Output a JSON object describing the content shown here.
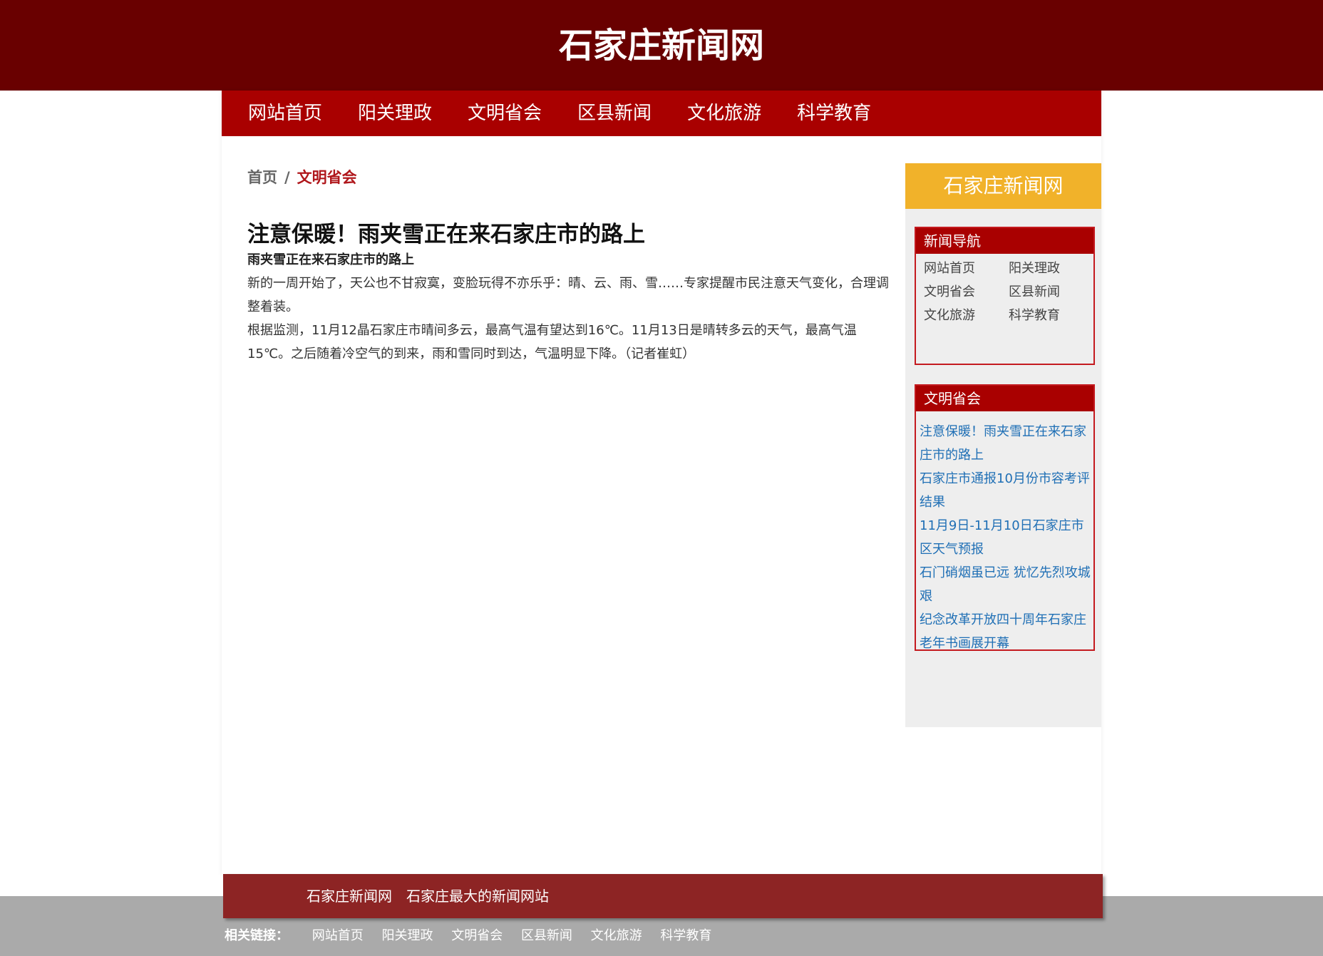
{
  "header": {
    "site_title": "石家庄新闻网"
  },
  "nav": {
    "items": [
      {
        "label": "网站首页"
      },
      {
        "label": "阳关理政"
      },
      {
        "label": "文明省会"
      },
      {
        "label": "区县新闻"
      },
      {
        "label": "文化旅游"
      },
      {
        "label": "科学教育"
      }
    ]
  },
  "breadcrumb": {
    "home": "首页",
    "separator": "/",
    "current": "文明省会"
  },
  "article": {
    "title": "注意保暖！雨夹雪正在来石家庄市的路上",
    "subtitle": "雨夹雪正在来石家庄市的路上",
    "paragraphs": [
      "新的一周开始了，天公也不甘寂寞，变脸玩得不亦乐乎：晴、云、雨、雪……专家提醒市民注意天气变化，合理调整着装。",
      "根据监测，11月12晶石家庄市晴间多云，最高气温有望达到16℃。11月13日是晴转多云的天气，最高气温15℃。之后随着冷空气的到来，雨和雪同时到达，气温明显下降。（记者崔虹）"
    ]
  },
  "sidebar": {
    "header": "石家庄新闻网",
    "news_nav": {
      "title": "新闻导航",
      "items": [
        "网站首页",
        "阳关理政",
        "文明省会",
        "区县新闻",
        "文化旅游",
        "科学教育"
      ]
    },
    "news_list": {
      "title": "文明省会",
      "items": [
        "注意保暖！雨夹雪正在来石家庄市的路上",
        "石家庄市通报10月份市容考评结果",
        "11月9日-11月10日石家庄市区天气预报",
        "石门硝烟虽已远 犹忆先烈攻城艰",
        "纪念改革开放四十周年石家庄老年书画展开幕"
      ]
    }
  },
  "footer": {
    "site_name": "石家庄新闻网",
    "slogan": "石家庄最大的新闻网站",
    "links_label": "相关链接：",
    "links": [
      "网站首页",
      "阳关理政",
      "文明省会",
      "区县新闻",
      "文化旅游",
      "科学教育"
    ]
  },
  "colors": {
    "header_bg": "#690000",
    "nav_bg": "#a90000",
    "sidebar_header_bg": "#f1b22a",
    "box_border": "#c41a1f",
    "link_blue": "#1f6fb5",
    "footer_bar_bg": "#8d2424",
    "footer_bg": "#aaaaaa"
  }
}
